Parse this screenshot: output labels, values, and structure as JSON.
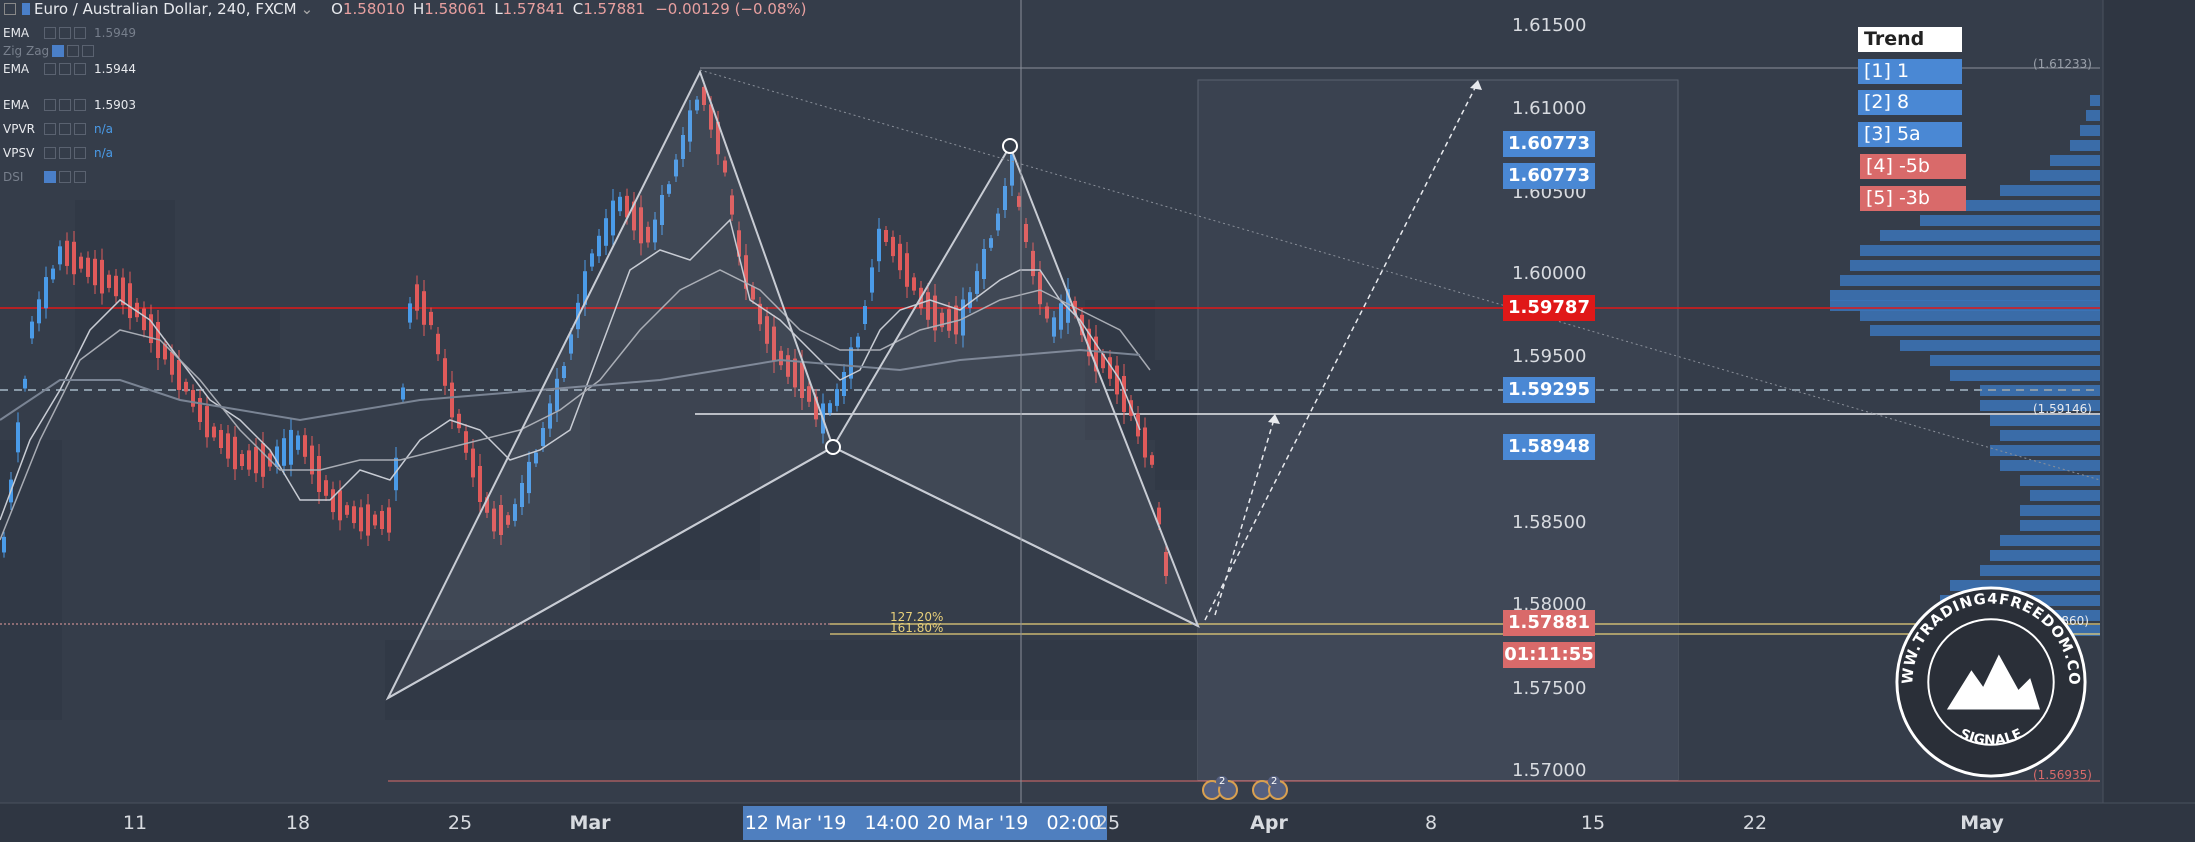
{
  "header": {
    "symbol": "Euro / Australian Dollar, 240, FXCM",
    "o_label": "O",
    "o_value": "1.58010",
    "h_label": "H",
    "h_value": "1.58061",
    "l_label": "L",
    "l_value": "1.57841",
    "c_label": "C",
    "c_value": "1.57881",
    "change": "−0.00129 (−0.08%)"
  },
  "indicators": [
    {
      "name": "EMA",
      "value": "1.5949",
      "dim_value": true
    },
    {
      "name": "Zig Zag",
      "value": "",
      "dim_name": true
    },
    {
      "name": "EMA",
      "value": "1.5944"
    },
    {
      "name": "EMA",
      "value": "1.5903"
    },
    {
      "name": "VPVR",
      "value": "n/a",
      "blue": true
    },
    {
      "name": "VPSV",
      "value": "n/a",
      "blue": true
    },
    {
      "name": "DSI",
      "value": "",
      "dim_name": true
    }
  ],
  "trend": {
    "title": "Trend",
    "items": [
      {
        "label": "[1] 1",
        "color": "#4a88d4"
      },
      {
        "label": "[2] 8",
        "color": "#4a88d4"
      },
      {
        "label": "[3] 5a",
        "color": "#4a88d4"
      },
      {
        "label": "[4] -5b",
        "color": "#d96a6a"
      },
      {
        "label": "[5] -3b",
        "color": "#d96a6a"
      }
    ]
  },
  "price_axis": {
    "labels": [
      "1.61500",
      "1.61000",
      "1.60500",
      "1.60000",
      "1.59500",
      "1.58500",
      "1.58000",
      "1.57500",
      "1.57000"
    ],
    "tags": [
      {
        "text": "1.60773",
        "color": "#4a88d4",
        "price": 1.60773
      },
      {
        "text": "1.60773",
        "color": "#4a88d4",
        "price": 1.60773
      },
      {
        "text": "1.59787",
        "color": "#e01818",
        "price": 1.59787
      },
      {
        "text": "1.59295",
        "color": "#4a88d4",
        "price": 1.59295
      },
      {
        "text": "1.58948",
        "color": "#4a88d4",
        "price": 1.58948
      },
      {
        "text": "1.57881",
        "color": "#d96a6a",
        "price": 1.57881
      },
      {
        "text": "01:11:55",
        "color": "#d96a6a",
        "price": 1.57881
      }
    ]
  },
  "levels": {
    "top": "(1.61233)",
    "mid": "(1.59146)",
    "low": "(1.57860)",
    "bottom": "(1.56935)",
    "fib1": "127.20%",
    "fib2": "161.80%"
  },
  "time_axis": {
    "ticks": [
      "11",
      "18",
      "25",
      "Mar",
      "25",
      "Apr",
      "8",
      "15",
      "22",
      "May"
    ],
    "box1": "12 Mar '19",
    "box1b": "14:00",
    "box2": "20 Mar '19",
    "box2b": "02:00"
  },
  "events": [
    "2",
    "2"
  ],
  "logo": {
    "ring_text": "WWW.TRADING4FREEDOM.COM",
    "bottom_text": "SIGNALE"
  },
  "colors": {
    "bg": "#353d4a",
    "up": "#4a9be8",
    "down": "#e05a5a",
    "accent_red": "#e01818"
  }
}
